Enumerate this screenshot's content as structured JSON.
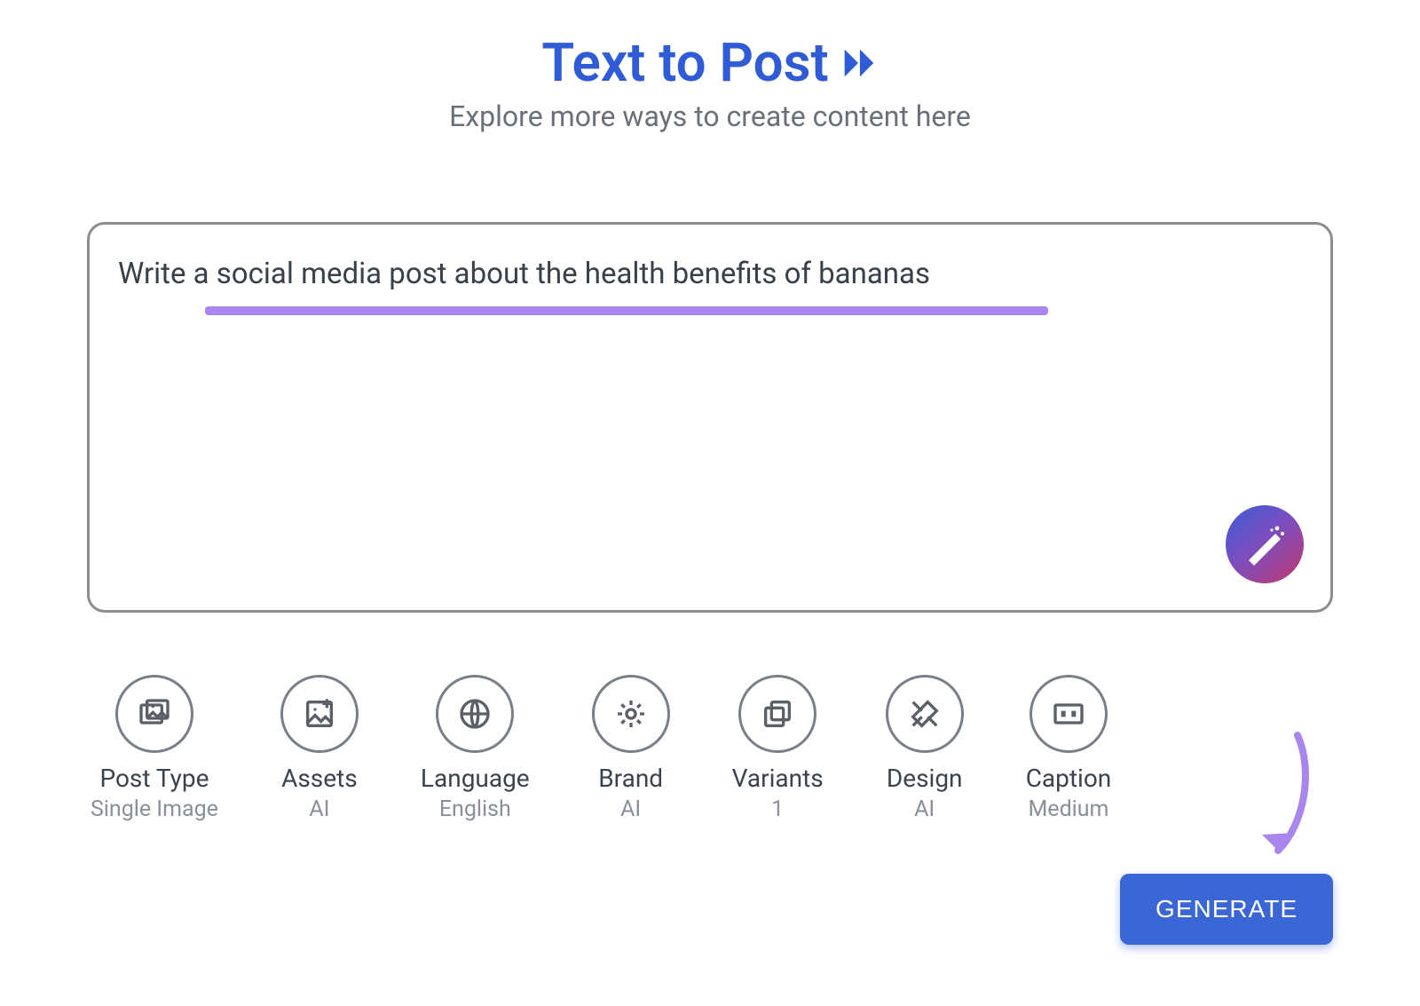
{
  "header": {
    "title": "Text to Post",
    "subtitle": "Explore more ways to create content here"
  },
  "prompt": {
    "text": "Write a social media post about the health benefits of bananas"
  },
  "options": [
    {
      "icon": "post-type-icon",
      "label": "Post Type",
      "value": "Single Image"
    },
    {
      "icon": "assets-icon",
      "label": "Assets",
      "value": "AI"
    },
    {
      "icon": "language-icon",
      "label": "Language",
      "value": "English"
    },
    {
      "icon": "brand-icon",
      "label": "Brand",
      "value": "AI"
    },
    {
      "icon": "variants-icon",
      "label": "Variants",
      "value": "1"
    },
    {
      "icon": "design-icon",
      "label": "Design",
      "value": "AI"
    },
    {
      "icon": "caption-icon",
      "label": "Caption",
      "value": "Medium"
    }
  ],
  "actions": {
    "generate": "GENERATE"
  },
  "colors": {
    "accent": "#2f5bd6",
    "underline": "#a986ee",
    "button": "#3a66d6"
  }
}
